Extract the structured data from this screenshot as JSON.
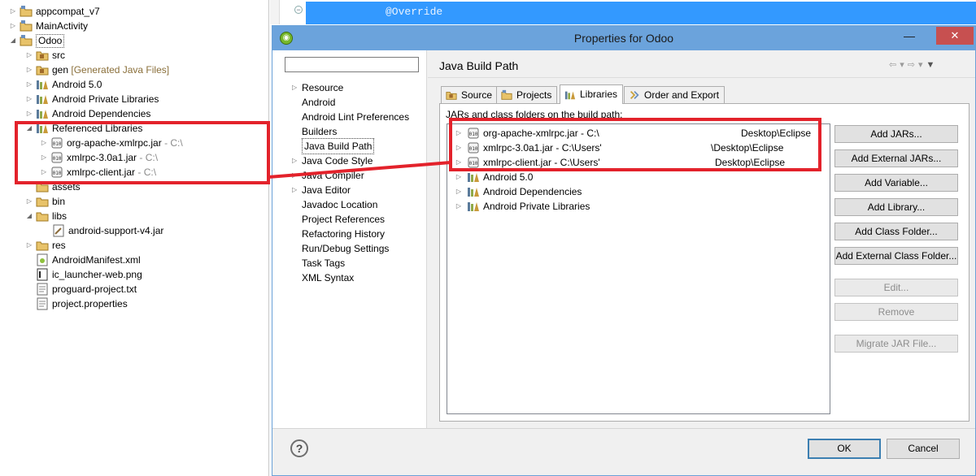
{
  "explorer": {
    "items": [
      {
        "label": "appcompat_v7",
        "suffix": ""
      },
      {
        "label": "MainActivity",
        "suffix": ""
      },
      {
        "label": "Odoo",
        "suffix": ""
      },
      {
        "label": "src",
        "suffix": ""
      },
      {
        "label": "gen",
        "suffix": "[Generated Java Files]"
      },
      {
        "label": "Android 5.0",
        "suffix": ""
      },
      {
        "label": "Android Private Libraries",
        "suffix": ""
      },
      {
        "label": "Android Dependencies",
        "suffix": ""
      },
      {
        "label": "Referenced Libraries",
        "suffix": ""
      },
      {
        "label": "org-apache-xmlrpc.jar",
        "suffix": "- C:\\"
      },
      {
        "label": "xmlrpc-3.0a1.jar",
        "suffix": "- C:\\"
      },
      {
        "label": "xmlrpc-client.jar",
        "suffix": "- C:\\"
      },
      {
        "label": "assets",
        "suffix": ""
      },
      {
        "label": "bin",
        "suffix": ""
      },
      {
        "label": "libs",
        "suffix": ""
      },
      {
        "label": "android-support-v4.jar",
        "suffix": ""
      },
      {
        "label": "res",
        "suffix": ""
      },
      {
        "label": "AndroidManifest.xml",
        "suffix": ""
      },
      {
        "label": "ic_launcher-web.png",
        "suffix": ""
      },
      {
        "label": "proguard-project.txt",
        "suffix": ""
      },
      {
        "label": "project.properties",
        "suffix": ""
      }
    ]
  },
  "editor": {
    "code_line": "@Override"
  },
  "dialog": {
    "title": "Properties for Odoo",
    "close_symbol": "✕",
    "minimize_symbol": "—",
    "filter_placeholder": "",
    "nav": [
      {
        "label": "Resource",
        "expandable": true
      },
      {
        "label": "Android",
        "expandable": false
      },
      {
        "label": "Android Lint Preferences",
        "expandable": false
      },
      {
        "label": "Builders",
        "expandable": false
      },
      {
        "label": "Java Build Path",
        "expandable": false
      },
      {
        "label": "Java Code Style",
        "expandable": true
      },
      {
        "label": "Java Compiler",
        "expandable": true
      },
      {
        "label": "Java Editor",
        "expandable": true
      },
      {
        "label": "Javadoc Location",
        "expandable": false
      },
      {
        "label": "Project References",
        "expandable": false
      },
      {
        "label": "Refactoring History",
        "expandable": false
      },
      {
        "label": "Run/Debug Settings",
        "expandable": false
      },
      {
        "label": "Task Tags",
        "expandable": false
      },
      {
        "label": "XML Syntax",
        "expandable": false
      }
    ],
    "page_title": "Java Build Path",
    "tabs": [
      "Source",
      "Projects",
      "Libraries",
      "Order and Export"
    ],
    "active_tab": "Libraries",
    "list_label": "JARs and class folders on the build path:",
    "libraries": [
      {
        "name": "org-apache-xmlrpc.jar - C:\\",
        "path": "Desktop\\Eclipse",
        "type": "jar"
      },
      {
        "name": "xmlrpc-3.0a1.jar - C:\\Users'",
        "path": "\\Desktop\\Eclipse",
        "type": "jar"
      },
      {
        "name": "xmlrpc-client.jar - C:\\Users'",
        "path": "Desktop\\Eclipse",
        "type": "jar"
      },
      {
        "name": "Android 5.0",
        "path": "",
        "type": "container"
      },
      {
        "name": "Android Dependencies",
        "path": "",
        "type": "container"
      },
      {
        "name": "Android Private Libraries",
        "path": "",
        "type": "container"
      }
    ],
    "buttons": {
      "add_jars": "Add JARs...",
      "add_external_jars": "Add External JARs...",
      "add_variable": "Add Variable...",
      "add_library": "Add Library...",
      "add_class_folder": "Add Class Folder...",
      "add_external_class_folder": "Add External Class Folder...",
      "edit": "Edit...",
      "remove": "Remove",
      "migrate_jar": "Migrate JAR File...",
      "ok": "OK",
      "cancel": "Cancel"
    },
    "help_symbol": "?"
  },
  "colors": {
    "annotation": "#e3222b",
    "titlebar": "#6ba3dc",
    "close": "#c75050",
    "editor_highlight": "#3399ff"
  }
}
